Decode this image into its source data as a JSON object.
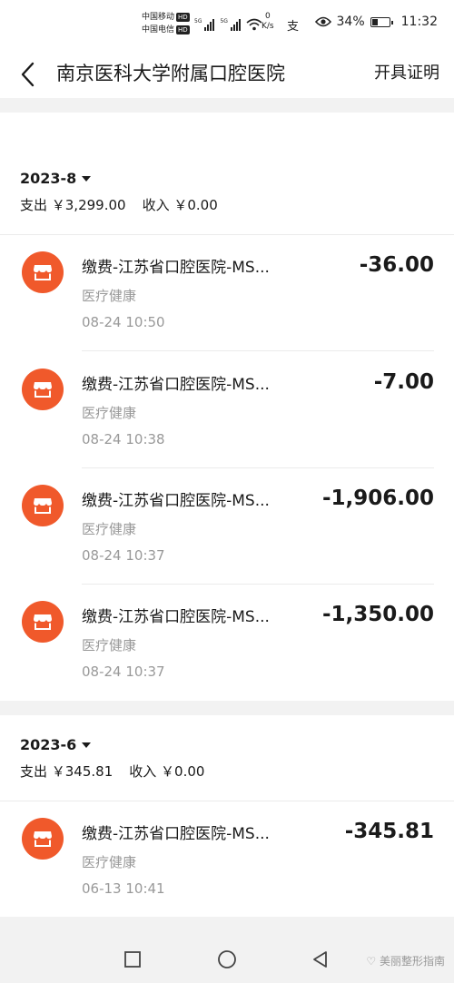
{
  "status_bar": {
    "carrier1": "中国移动",
    "carrier2": "中国电信",
    "hd": "HD",
    "sig1_label": "5G",
    "sig2_label": "5G",
    "speed_value": "0",
    "speed_unit": "K/s",
    "app_glyph": "支",
    "battery": "34%",
    "battery_level": 0.34,
    "time": "11:32"
  },
  "header": {
    "title": "南京医科大学附属口腔医院",
    "action": "开具证明",
    "back_icon": "chevron-left-icon"
  },
  "groups": [
    {
      "month": "2023-8",
      "expense": "支出 ￥3,299.00",
      "income": "收入 ￥0.00",
      "transactions": [
        {
          "name": "缴费-江苏省口腔医院-MS...",
          "category": "医疗健康",
          "time": "08-24  10:50",
          "amount": "-36.00"
        },
        {
          "name": "缴费-江苏省口腔医院-MS...",
          "category": "医疗健康",
          "time": "08-24  10:38",
          "amount": "-7.00"
        },
        {
          "name": "缴费-江苏省口腔医院-MS...",
          "category": "医疗健康",
          "time": "08-24  10:37",
          "amount": "-1,906.00"
        },
        {
          "name": "缴费-江苏省口腔医院-MS...",
          "category": "医疗健康",
          "time": "08-24  10:37",
          "amount": "-1,350.00"
        }
      ]
    },
    {
      "month": "2023-6",
      "expense": "支出 ￥345.81",
      "income": "收入 ￥0.00",
      "transactions": [
        {
          "name": "缴费-江苏省口腔医院-MS...",
          "category": "医疗健康",
          "time": "06-13  10:41",
          "amount": "-345.81"
        }
      ]
    }
  ],
  "system_nav": {
    "recent_icon": "square-icon",
    "home_icon": "circle-icon",
    "back_icon": "triangle-back-icon"
  },
  "watermark": "美丽整形指南",
  "colors": {
    "accent": "#f0592b",
    "secondary_text": "#999999",
    "background": "#f2f2f2"
  }
}
